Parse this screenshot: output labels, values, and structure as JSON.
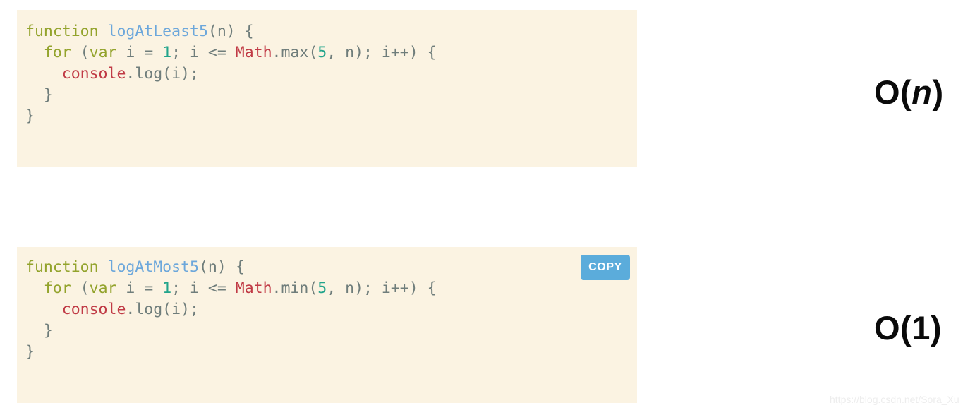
{
  "code_blocks": [
    {
      "id": "log-at-least-5",
      "language": "javascript",
      "background_color": "#FBF3E2",
      "lines": [
        [
          {
            "t": "function",
            "c": "kw"
          },
          {
            "t": " ",
            "c": "plain"
          },
          {
            "t": "logAtLeast5",
            "c": "fnname"
          },
          {
            "t": "(n) {",
            "c": "punct"
          }
        ],
        [
          {
            "t": "  ",
            "c": "plain"
          },
          {
            "t": "for",
            "c": "kw"
          },
          {
            "t": " (",
            "c": "punct"
          },
          {
            "t": "var",
            "c": "kw"
          },
          {
            "t": " i = ",
            "c": "punct"
          },
          {
            "t": "1",
            "c": "num"
          },
          {
            "t": "; i <= ",
            "c": "punct"
          },
          {
            "t": "Math",
            "c": "obj"
          },
          {
            "t": ".max(",
            "c": "punct"
          },
          {
            "t": "5",
            "c": "num"
          },
          {
            "t": ", n); i++) {",
            "c": "punct"
          }
        ],
        [
          {
            "t": "    ",
            "c": "plain"
          },
          {
            "t": "console",
            "c": "obj"
          },
          {
            "t": ".log(i);",
            "c": "punct"
          }
        ],
        [
          {
            "t": "  }",
            "c": "brace"
          }
        ],
        [
          {
            "t": "}",
            "c": "brace"
          }
        ]
      ]
    },
    {
      "id": "log-at-most-5",
      "language": "javascript",
      "background_color": "#FBF3E2",
      "lines": [
        [
          {
            "t": "function",
            "c": "kw"
          },
          {
            "t": " ",
            "c": "plain"
          },
          {
            "t": "logAtMost5",
            "c": "fnname"
          },
          {
            "t": "(n) {",
            "c": "punct"
          }
        ],
        [
          {
            "t": "  ",
            "c": "plain"
          },
          {
            "t": "for",
            "c": "kw"
          },
          {
            "t": " (",
            "c": "punct"
          },
          {
            "t": "var",
            "c": "kw"
          },
          {
            "t": " i = ",
            "c": "punct"
          },
          {
            "t": "1",
            "c": "num"
          },
          {
            "t": "; i <= ",
            "c": "punct"
          },
          {
            "t": "Math",
            "c": "obj"
          },
          {
            "t": ".min(",
            "c": "punct"
          },
          {
            "t": "5",
            "c": "num"
          },
          {
            "t": ", n); i++) {",
            "c": "punct"
          }
        ],
        [
          {
            "t": "    ",
            "c": "plain"
          },
          {
            "t": "console",
            "c": "obj"
          },
          {
            "t": ".log(i);",
            "c": "punct"
          }
        ],
        [
          {
            "t": "  }",
            "c": "brace"
          }
        ],
        [
          {
            "t": "}",
            "c": "brace"
          }
        ]
      ]
    }
  ],
  "copy_button": {
    "label": "COPY",
    "color": "#5BACDB"
  },
  "complexity_labels": [
    {
      "prefix": "O(",
      "variable": "n",
      "suffix": ")",
      "full": "O(n)"
    },
    {
      "prefix": "O(",
      "variable": "1",
      "suffix": ")",
      "full": "O(1)",
      "italic": false
    }
  ],
  "watermark": {
    "text": "https://blog.csdn.net/Sora_Xu",
    "color": "#EDEDED"
  },
  "syntax_colors": {
    "keyword": "#93A32C",
    "function_name": "#6CA7DB",
    "punctuation": "#6F7D7B",
    "number": "#22A48B",
    "object": "#C03A45",
    "background": "#FBF3E2"
  }
}
